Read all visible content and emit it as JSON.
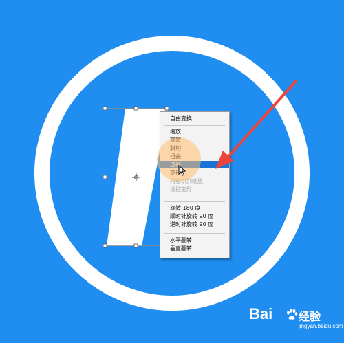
{
  "context_menu": {
    "items": [
      {
        "label": "自由变换",
        "state": "normal"
      },
      {
        "label": "缩放",
        "state": "normal"
      },
      {
        "label": "旋转",
        "state": "normal"
      },
      {
        "label": "斜切",
        "state": "normal"
      },
      {
        "label": "扭曲",
        "state": "normal"
      },
      {
        "label": "透视",
        "state": "selected"
      },
      {
        "label": "变形",
        "state": "normal"
      },
      {
        "label": "内容识别缩放",
        "state": "disabled"
      },
      {
        "label": "操控变形",
        "state": "disabled"
      },
      {
        "label": "旋转 180 度",
        "state": "normal"
      },
      {
        "label": "顺时针旋转 90 度",
        "state": "normal"
      },
      {
        "label": "逆时针旋转 90 度",
        "state": "normal"
      },
      {
        "label": "水平翻转",
        "state": "normal"
      },
      {
        "label": "垂直翻转",
        "state": "normal"
      }
    ],
    "selected_color": "#1a73d9"
  },
  "canvas": {
    "background_color": "#1f8ef0",
    "shape_color": "#ffffff",
    "annotation_arrow_color": "#e8453c"
  },
  "watermark": {
    "brand": "Bai",
    "paw_icon": "baidu-paw-icon",
    "brand_suffix": "经验",
    "url": "jingyan.baidu.com"
  }
}
